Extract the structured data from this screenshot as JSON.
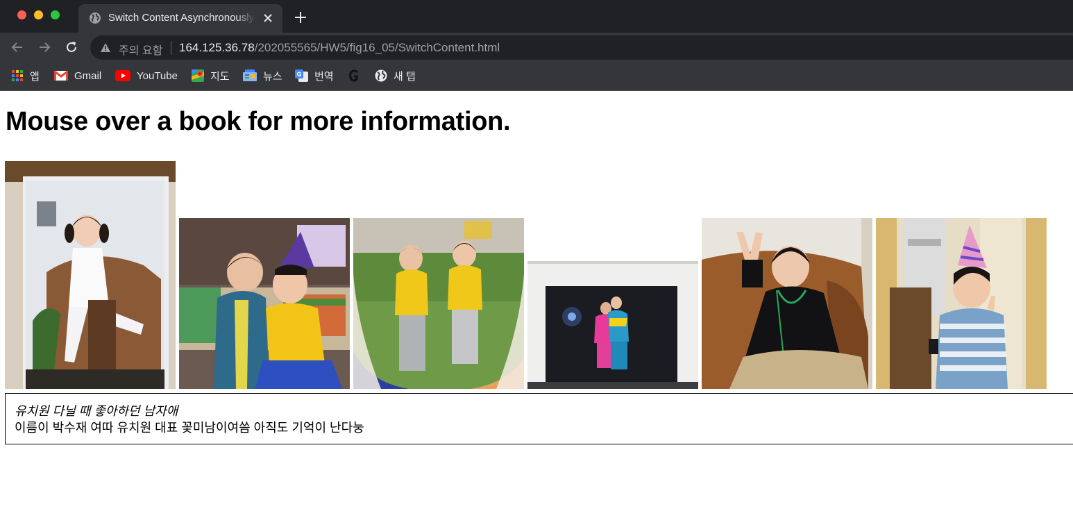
{
  "browser": {
    "tab": {
      "title": "Switch Content Asynchronously"
    },
    "address_bar": {
      "security_label": "주의 요함",
      "url_host": "164.125.36.78",
      "url_path": "/202055565/HW5/fig16_05/SwitchContent.html"
    },
    "bookmarks": [
      {
        "label": "앱",
        "icon": "apps-grid-icon"
      },
      {
        "label": "Gmail",
        "icon": "gmail-icon"
      },
      {
        "label": "YouTube",
        "icon": "youtube-icon"
      },
      {
        "label": "지도",
        "icon": "maps-icon"
      },
      {
        "label": "뉴스",
        "icon": "news-icon"
      },
      {
        "label": "번역",
        "icon": "translate-icon"
      },
      {
        "label": "",
        "icon": "g-logo-icon"
      },
      {
        "label": "새 탭",
        "icon": "globe-icon"
      }
    ]
  },
  "page": {
    "heading": "Mouse over a book for more information.",
    "photos": [
      {
        "icon": "photo-girl-on-sofa"
      },
      {
        "icon": "photo-two-kids-kiss"
      },
      {
        "icon": "photo-two-kids-outdoor"
      },
      {
        "icon": "photo-kids-in-frame"
      },
      {
        "icon": "photo-girl-v-sign"
      },
      {
        "icon": "photo-boy-party-hat"
      }
    ],
    "info": {
      "title": "유치원 다닐 때 좋아하던 남자애",
      "description": "이름이 박수재 여따 유치원 대표 꽃미남이여씀 아직도 기억이 난다눙"
    }
  },
  "colors": {
    "chrome_dark": "#202124",
    "chrome_mid": "#35363a",
    "chrome_text": "#e8eaed",
    "chrome_dim": "#9aa0a6"
  }
}
